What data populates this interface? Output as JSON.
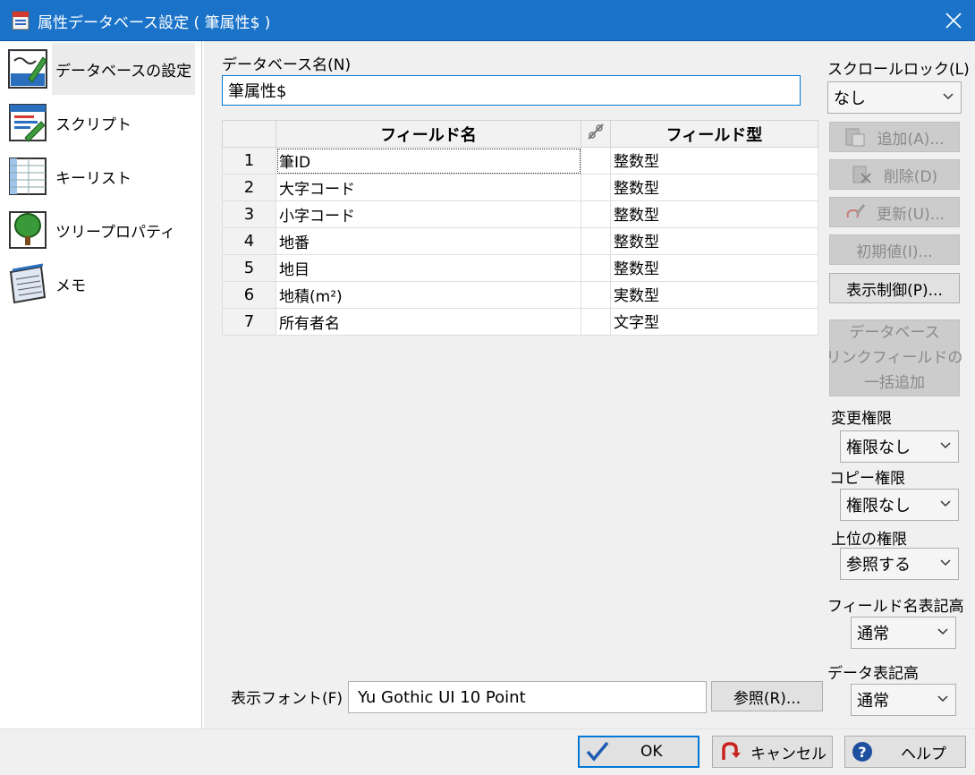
{
  "window": {
    "title": "属性データベース設定 ( 筆属性$ )"
  },
  "sidebar": {
    "items": [
      {
        "label": "データベースの設定",
        "icon": "database-settings-icon",
        "active": true
      },
      {
        "label": "スクリプト",
        "icon": "script-icon"
      },
      {
        "label": "キーリスト",
        "icon": "key-list-icon"
      },
      {
        "label": "ツリープロパティ",
        "icon": "tree-icon"
      },
      {
        "label": "メモ",
        "icon": "memo-icon"
      }
    ]
  },
  "database": {
    "name_label": "データベース名(N)",
    "name_value": "筆属性$"
  },
  "grid": {
    "columns": [
      "フィールド名",
      "",
      "フィールド型"
    ],
    "rows": [
      {
        "num": "1",
        "name": "筆ID",
        "type": "整数型"
      },
      {
        "num": "2",
        "name": "大字コード",
        "type": "整数型"
      },
      {
        "num": "3",
        "name": "小字コード",
        "type": "整数型"
      },
      {
        "num": "4",
        "name": "地番",
        "type": "整数型"
      },
      {
        "num": "5",
        "name": "地目",
        "type": "整数型"
      },
      {
        "num": "6",
        "name": "地積(m²)",
        "type": "実数型"
      },
      {
        "num": "7",
        "name": "所有者名",
        "type": "文字型"
      }
    ]
  },
  "font": {
    "label": "表示フォント(F)",
    "value": "Yu Gothic UI 10 Point",
    "browse_label": "参照(R)..."
  },
  "right": {
    "scroll_lock_label": "スクロールロック(L)",
    "scroll_lock_value": "なし",
    "add_label": "追加(A)...",
    "delete_label": "削除(D)",
    "update_label": "更新(U)...",
    "initial_label": "初期値(I)...",
    "display_control_label": "表示制御(P)...",
    "link_field_label_1": "データベース",
    "link_field_label_2": "リンクフィールドの",
    "link_field_label_3": "一括追加",
    "change_perm_label": "変更権限",
    "change_perm_value": "権限なし",
    "copy_perm_label": "コピー権限",
    "copy_perm_value": "権限なし",
    "upper_perm_label": "上位の権限",
    "upper_perm_value": "参照する",
    "field_name_height_label": "フィールド名表記高",
    "field_name_height_value": "通常",
    "data_height_label": "データ表記高",
    "data_height_value": "通常"
  },
  "footer": {
    "ok_label": "OK",
    "cancel_label": "キャンセル",
    "help_label": "ヘルプ"
  },
  "colors": {
    "titlebar": "#1a73c9",
    "focus": "#0078d7",
    "disabled": "#cccccc"
  }
}
